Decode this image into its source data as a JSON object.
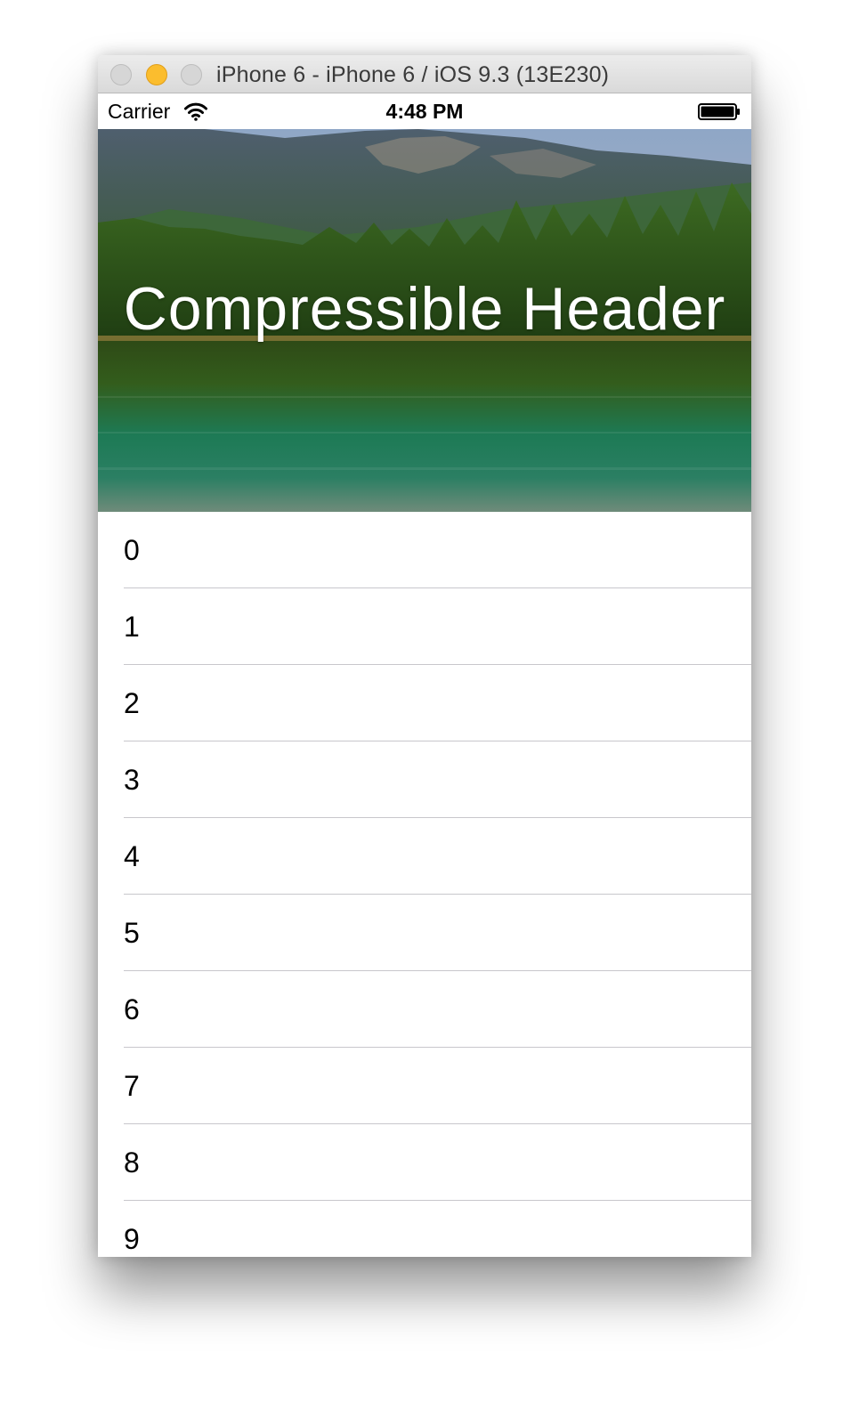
{
  "window": {
    "title": "iPhone 6 - iPhone 6 / iOS 9.3 (13E230)",
    "buttons": [
      "close",
      "minimize",
      "zoom"
    ]
  },
  "status_bar": {
    "carrier": "Carrier",
    "time": "4:48 PM",
    "wifi_icon": "wifi-icon",
    "battery_icon": "battery-icon"
  },
  "header": {
    "title": "Compressible Header",
    "image": "mountain lake landscape"
  },
  "list": {
    "items": [
      "0",
      "1",
      "2",
      "3",
      "4",
      "5",
      "6",
      "7",
      "8",
      "9"
    ]
  },
  "colors": {
    "minimize_button": "#fbbd2e",
    "separator": "#c8c7cc",
    "header_text": "#ffffff"
  }
}
